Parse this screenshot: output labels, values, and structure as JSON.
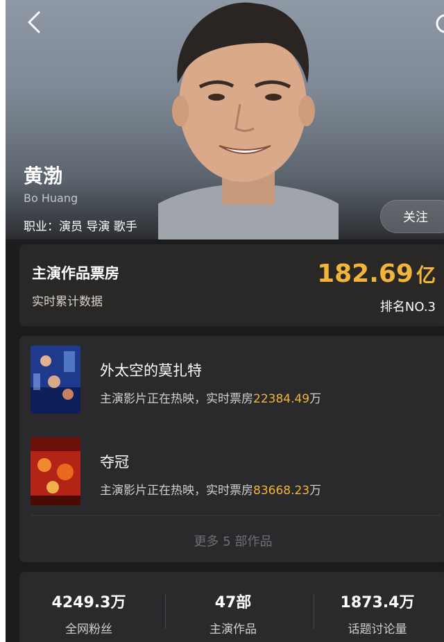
{
  "profile": {
    "name": "黄渤",
    "name_en": "Bo Huang",
    "occupation": "职业：演员 导演 歌手",
    "follow_label": "关注"
  },
  "box_office": {
    "title": "主演作品票房",
    "subtitle": "实时累计数据",
    "value": "182.69",
    "unit": "亿",
    "rank": "排名NO.3"
  },
  "works": {
    "items": [
      {
        "title": "外太空的莫扎特",
        "desc_prefix": "主演影片正在热映，实时票房",
        "gross": "22384.49",
        "gross_unit": "万"
      },
      {
        "title": "夺冠",
        "desc_prefix": "主演影片正在热映，实时票房",
        "gross": "83668.23",
        "gross_unit": "万"
      }
    ],
    "more_label": "更多 5 部作品"
  },
  "stats": [
    {
      "value": "4249.3万",
      "label": "全网粉丝"
    },
    {
      "value": "47部",
      "label": "主演作品"
    },
    {
      "value": "1873.4万",
      "label": "话题讨论量"
    }
  ],
  "colors": {
    "accent": "#f2b53a",
    "background": "#1c1c1e",
    "card": "#2a2a2c"
  },
  "icons": {
    "back": "chevron-left-icon",
    "share": "share-icon"
  }
}
